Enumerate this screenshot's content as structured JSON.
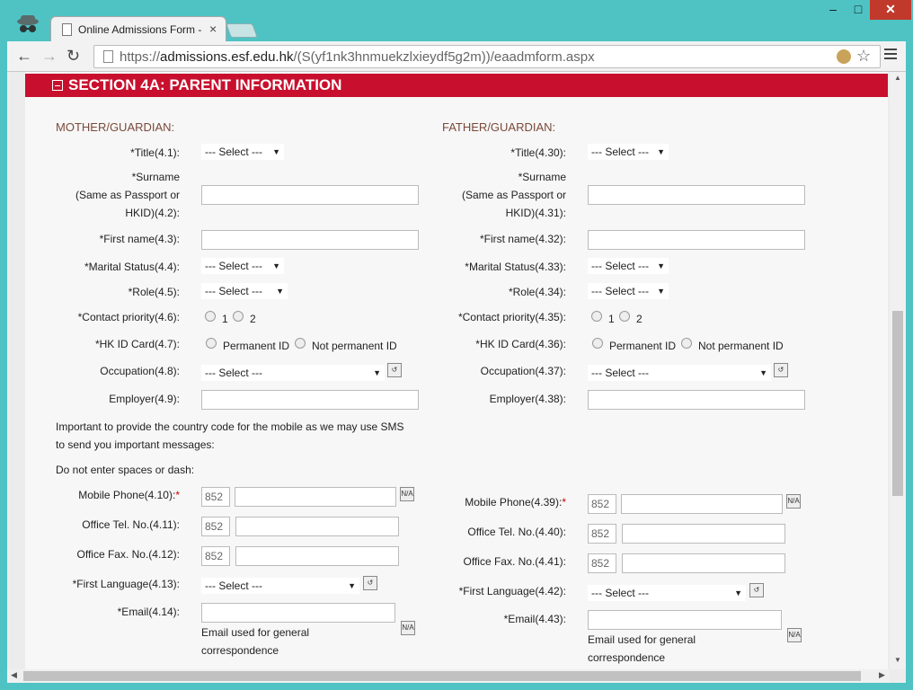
{
  "browser": {
    "tab_title": "Online Admissions Form -",
    "tab_close": "×",
    "url_prefix": "https://",
    "url_host": "admissions.esf.edu.hk",
    "url_path": "/(S(yf1nk3hnmuekzlxieydf5g2m))/eaadmform.aspx",
    "win_min": "–",
    "win_max": "□",
    "win_close": "✕",
    "back": "←",
    "forward": "→",
    "reload": "↻",
    "star": "☆"
  },
  "section": {
    "title": "SECTION 4A: PARENT INFORMATION"
  },
  "mother": {
    "heading": "MOTHER/GUARDIAN:",
    "title_label": "*Title",
    "title_num": "(4.1):",
    "surname_l1": "*Surname",
    "surname_l2": "(Same as Passport or",
    "surname_l3": "HKID)(4.2):",
    "firstname_label": "*First name(4.3):",
    "marital_label": "*Marital Status(4.4):",
    "role_label": "*Role(4.5):",
    "contact_label": "*Contact priority(4.6):",
    "hkid_label": "*HK ID Card(4.7):",
    "occupation_label": "Occupation(4.8):",
    "employer_label": "Employer(4.9):",
    "mobile_label": "Mobile Phone(4.10):",
    "office_tel_label": "Office Tel. No.(4.11):",
    "office_fax_label": "Office Fax. No.(4.12):",
    "language_label": "*First Language(4.13):",
    "email_label": "*Email(4.14):"
  },
  "father": {
    "heading": "FATHER/GUARDIAN:",
    "title_label": "*Title",
    "title_num": "(4.30):",
    "surname_l1": "*Surname",
    "surname_l2": "(Same as Passport or",
    "surname_l3": "HKID)(4.31):",
    "firstname_label": "*First name(4.32):",
    "marital_label": "*Marital Status(4.33):",
    "role_label": "*Role(4.34):",
    "contact_label": "*Contact priority(4.35):",
    "hkid_label": "*HK ID Card(4.36):",
    "occupation_label": "Occupation(4.37):",
    "employer_label": "Employer(4.38):",
    "mobile_label": "Mobile Phone(4.39):",
    "office_tel_label": "Office Tel. No.(4.40):",
    "office_fax_label": "Office Fax. No.(4.41):",
    "language_label": "*First Language(4.42):",
    "email_label": "*Email(4.43):"
  },
  "common": {
    "select": "--- Select ---",
    "opt1": "1",
    "opt2": "2",
    "permanent": "Permanent ID",
    "not_permanent": "Not permanent ID",
    "country_code": "852",
    "req_star": "*",
    "na_icon": "N/A",
    "reset_icon": "↺",
    "email_note_l1": "Email used for general",
    "email_note_l2": "correspondence",
    "sms_note_l1": "Important to provide the country code for the mobile as we may use SMS",
    "sms_note_l2": "to send you important messages:",
    "dash_note": "Do not enter spaces or dash:"
  }
}
